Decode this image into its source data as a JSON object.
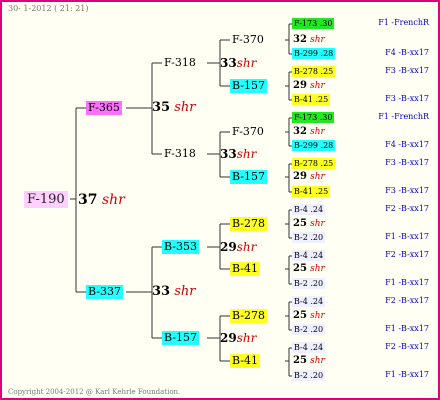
{
  "header": "30-  1-2012 ( 21: 21)",
  "copyright": "Copyright 2004-2012 @ Karl Kehrle Foundation.",
  "root": {
    "label": "F-190",
    "coef": "37",
    "unit": "shr"
  },
  "gen1": [
    {
      "label": "F-365",
      "coef": "35",
      "unit": "shr"
    },
    {
      "label": "B-337",
      "coef": "33",
      "unit": "shr"
    }
  ],
  "gen2": [
    {
      "label": "F-318",
      "coef": "33",
      "unit": "shr"
    },
    {
      "label": "F-318",
      "coef": "33",
      "unit": "shr"
    },
    {
      "label": "B-353",
      "coef": "29",
      "unit": "shr"
    },
    {
      "label": "B-157",
      "coef": "29",
      "unit": "shr"
    }
  ],
  "gen3": [
    {
      "label": "F-370",
      "coef": "32",
      "unit": "shr"
    },
    {
      "label": "B-157",
      "coef": "29",
      "unit": "shr"
    },
    {
      "label": "F-370",
      "coef": "32",
      "unit": "shr"
    },
    {
      "label": "B-157",
      "coef": "29",
      "unit": "shr"
    },
    {
      "label": "B-278",
      "coef": "25",
      "unit": "shr"
    },
    {
      "label": "B-41",
      "coef": "25",
      "unit": "shr"
    },
    {
      "label": "B-278",
      "coef": "25",
      "unit": "shr"
    },
    {
      "label": "B-41",
      "coef": "25",
      "unit": "shr"
    }
  ],
  "gen4": [
    {
      "label": "F-173 .30",
      "family": "F1 -FrenchR"
    },
    {
      "label": "B-299 .28",
      "family": "F4 -B-xx17"
    },
    {
      "label": "B-278 .25",
      "family": "F3 -B-xx17"
    },
    {
      "label": "B-41 .25",
      "family": "F3 -B-xx17"
    },
    {
      "label": "F-173 .30",
      "family": "F1 -FrenchR"
    },
    {
      "label": "B-299 .28",
      "family": "F4 -B-xx17"
    },
    {
      "label": "B-278 .25",
      "family": "F3 -B-xx17"
    },
    {
      "label": "B-41 .25",
      "family": "F3 -B-xx17"
    },
    {
      "label": "B-4 .24",
      "family": "F2 -B-xx17"
    },
    {
      "label": "B-2 .20",
      "family": "F1 -B-xx17"
    },
    {
      "label": "B-4 .24",
      "family": "F2 -B-xx17"
    },
    {
      "label": "B-2 .20",
      "family": "F1 -B-xx17"
    },
    {
      "label": "B-4 .24",
      "family": "F2 -B-xx17"
    },
    {
      "label": "B-2 .20",
      "family": "F1 -B-xx17"
    },
    {
      "label": "B-4 .24",
      "family": "F2 -B-xx17"
    },
    {
      "label": "B-2 .20",
      "family": "F1 -B-xx17"
    }
  ],
  "colors": {
    "frame": "#e0007c",
    "pink": "#ff6fff",
    "cyan": "#22ffff",
    "yellow": "#ffff22",
    "green": "#22e822",
    "coefficient_unit": "#cc0000",
    "family": "#0000cc"
  }
}
